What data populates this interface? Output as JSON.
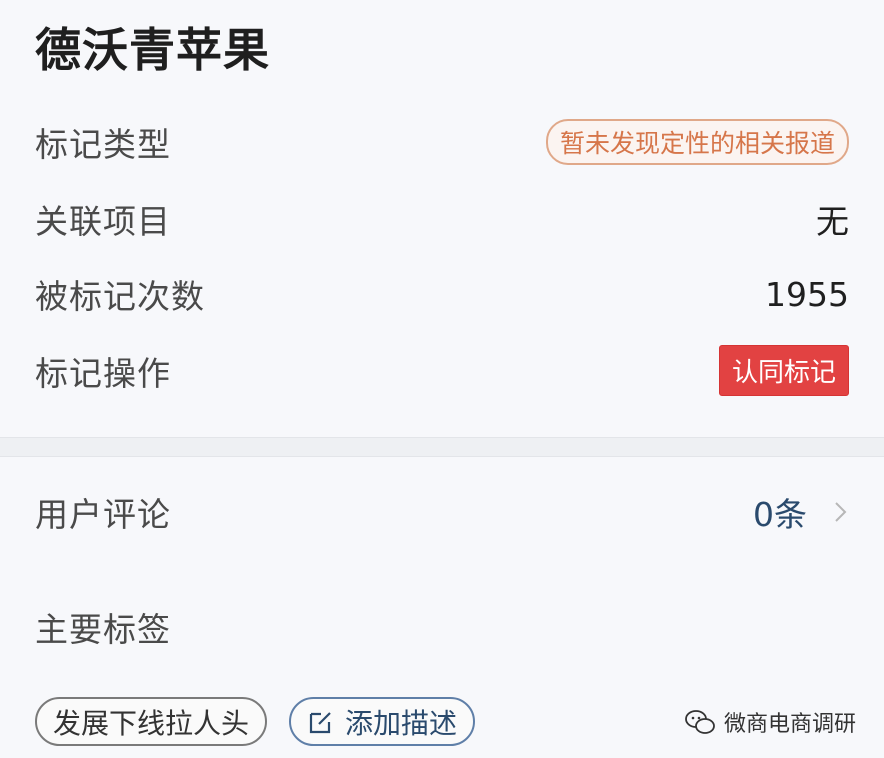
{
  "header": {
    "title": "德沃青苹果"
  },
  "details": {
    "mark_type_label": "标记类型",
    "mark_type_value": "暂未发现定性的相关报道",
    "related_project_label": "关联项目",
    "related_project_value": "无",
    "mark_count_label": "被标记次数",
    "mark_count_value": "1955",
    "mark_action_label": "标记操作",
    "mark_action_button": "认同标记"
  },
  "comments": {
    "label": "用户评论",
    "count": "0条"
  },
  "tags": {
    "label": "主要标签",
    "items": [
      "发展下线拉人头"
    ],
    "add_label": "添加描述"
  },
  "watermark": {
    "text": "微商电商调研"
  },
  "colors": {
    "accent_red": "#e24242",
    "tag_orange": "#d6764a",
    "link_blue": "#2a4a6d"
  }
}
